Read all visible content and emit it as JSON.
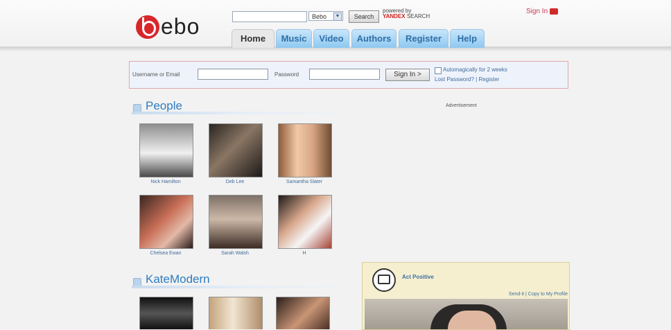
{
  "header": {
    "logo_text": "ebo",
    "search": {
      "placeholder": "",
      "scope": "Bebo",
      "button": "Search",
      "powered_line1": "powered by",
      "powered_yandex": "YANDEX",
      "powered_line2": "SEARCH"
    },
    "sign_in": "Sign In"
  },
  "tabs": [
    {
      "label": "Home"
    },
    {
      "label": "Music"
    },
    {
      "label": "Video"
    },
    {
      "label": "Authors"
    },
    {
      "label": "Register"
    },
    {
      "label": "Help"
    }
  ],
  "login": {
    "username_label": "Username or Email",
    "password_label": "Password",
    "button": "Sign In >",
    "auto_label": "Automagically for 2 weeks",
    "lost_password": "Lost Password?",
    "register": "Register"
  },
  "people": {
    "title": "People",
    "items": [
      {
        "name": "Nick Hamilton"
      },
      {
        "name": "Deb Lee"
      },
      {
        "name": "Samantha Slater"
      },
      {
        "name": "Chelsea Ewan"
      },
      {
        "name": "Sarah Walsh"
      },
      {
        "name": "H"
      }
    ]
  },
  "katemodern": {
    "title": "KateModern"
  },
  "sidebar": {
    "advertisement": "Advertisement",
    "act_positive": {
      "title": "Act Positive",
      "links": "Send-it | Copy to My Profile"
    }
  },
  "colors": {
    "brand_red": "#d8262b",
    "link_blue": "#416b9b",
    "tab_blue": "#8ec8f0"
  }
}
